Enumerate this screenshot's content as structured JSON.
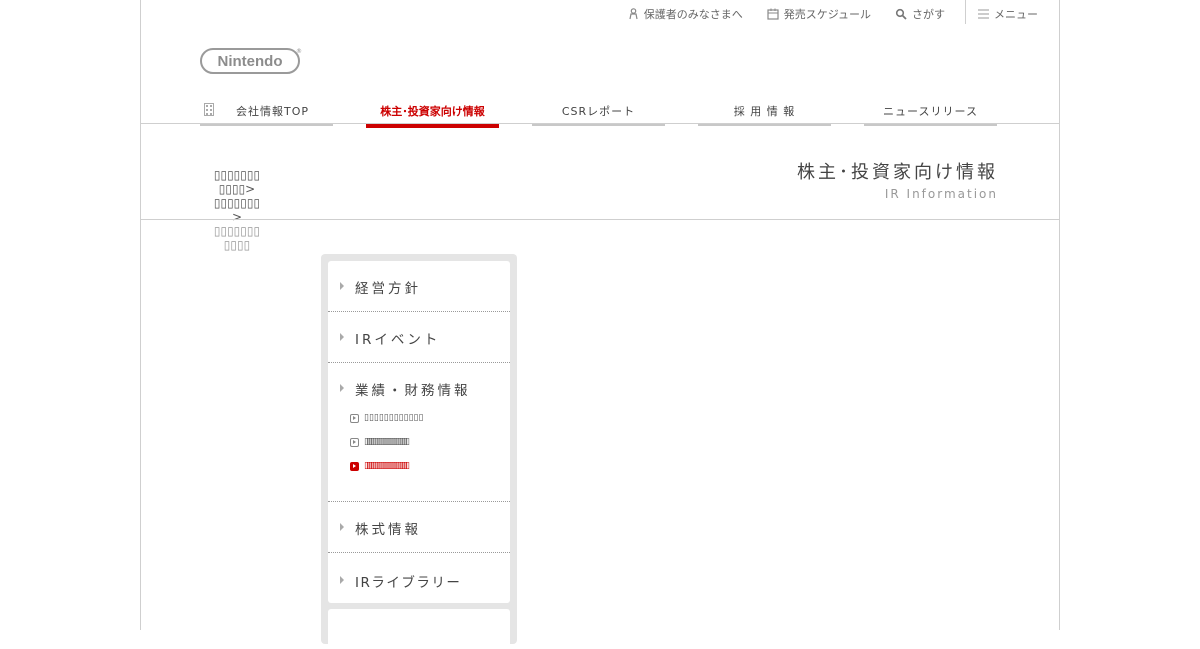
{
  "utility_nav": {
    "guardians": "保護者のみなさまへ",
    "schedule": "発売スケジュール",
    "search": "さがす",
    "menu": "メニュー"
  },
  "logo": {
    "text": "Nintendo",
    "mark": "®"
  },
  "global_nav": {
    "tabs": [
      {
        "label": "会社情報TOP"
      },
      {
        "label": "株主･投資家向け情報"
      },
      {
        "label": "CSRレポート"
      },
      {
        "label": "採 用 情 報"
      },
      {
        "label": "ニュースリリース"
      }
    ],
    "active_index": 1
  },
  "page_header": {
    "title": "株主･投資家向け情報",
    "subtitle": "IR Information"
  },
  "breadcrumb": {
    "line1": "▯▯▯▯▯▯▯▯▯▯▯>",
    "line2": "▯▯▯▯▯▯▯>",
    "line3": "▯▯▯▯▯▯▯▯▯▯▯"
  },
  "sidebar": {
    "items": [
      {
        "label": "経営方針"
      },
      {
        "label": "IRイベント"
      },
      {
        "label": "業績・財務情報"
      },
      {
        "label": "株式情報"
      },
      {
        "label": "IRライブラリー"
      }
    ],
    "sub_items": [
      {
        "label": "▯▯▯▯▯▯▯▯▯▯▯▯",
        "current": false
      },
      {
        "label": "▯▯▯▯▯▯▯▯▯▯▯▯▯▯▯▯▯▯▯▯▯▯",
        "current": false
      },
      {
        "label": "▯▯▯▯▯▯▯▯▯▯▯▯▯▯▯▯▯▯▯▯▯▯",
        "current": true
      }
    ]
  },
  "colors": {
    "accent": "#cc0000",
    "rule": "#cfcfcf",
    "sidebar_bg": "#e5e5e5"
  }
}
